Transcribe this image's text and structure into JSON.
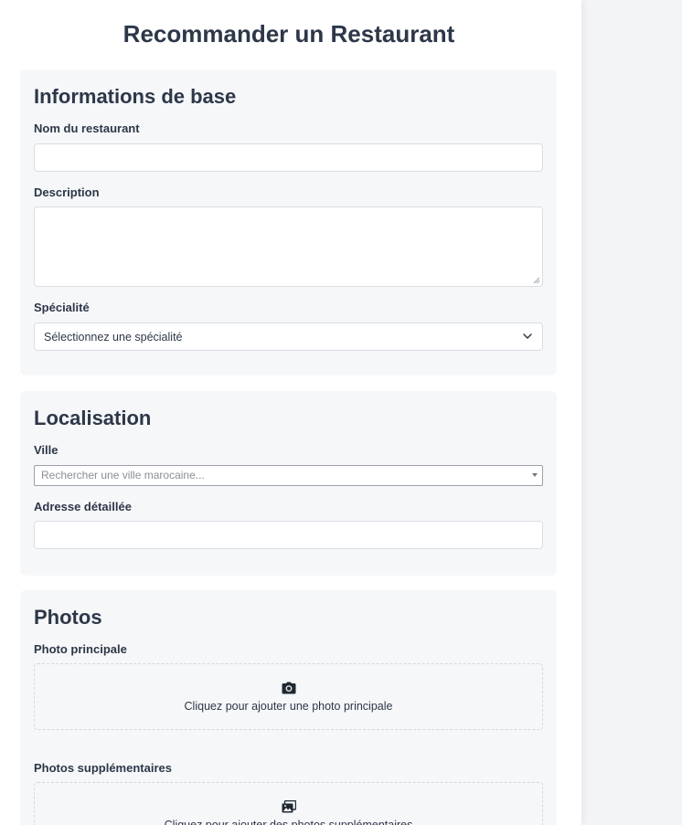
{
  "page": {
    "title": "Recommander un Restaurant"
  },
  "basic_info": {
    "heading": "Informations de base",
    "name_label": "Nom du restaurant",
    "name_value": "",
    "description_label": "Description",
    "description_value": "",
    "specialty_label": "Spécialité",
    "specialty_selected": "Sélectionnez une spécialité"
  },
  "location": {
    "heading": "Localisation",
    "city_label": "Ville",
    "city_placeholder": "Rechercher une ville marocaine...",
    "address_label": "Adresse détaillée",
    "address_value": ""
  },
  "photos": {
    "heading": "Photos",
    "main_label": "Photo principale",
    "main_icon": "camera-icon",
    "main_prompt": "Cliquez pour ajouter une photo principale",
    "extra_label": "Photos supplémentaires",
    "extra_icon": "images-icon",
    "extra_prompt": "Cliquez pour ajouter des photos supplémentaires"
  },
  "colors": {
    "text": "#2d3748",
    "section_bg": "#f6f7f9",
    "border": "#d9dde3",
    "page_bg": "#f3f4f6"
  }
}
